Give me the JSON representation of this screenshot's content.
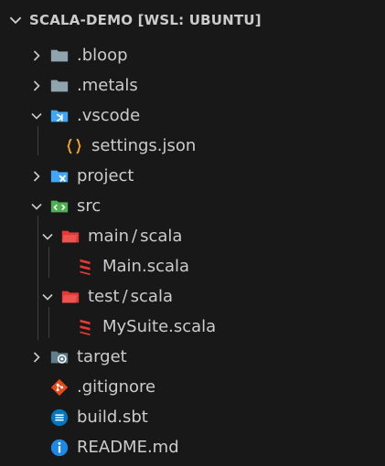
{
  "header": {
    "title": "SCALA-DEMO [WSL: UBUNTU]"
  },
  "tree": {
    "bloop": {
      "label": ".bloop",
      "icon": "folder-icon"
    },
    "metals": {
      "label": ".metals",
      "icon": "folder-icon"
    },
    "vscode": {
      "label": ".vscode",
      "icon": "vscode-folder-icon"
    },
    "settings": {
      "label": "settings.json",
      "icon": "json-icon"
    },
    "project": {
      "label": "project",
      "icon": "project-folder-icon"
    },
    "src": {
      "label": "src",
      "icon": "src-folder-icon"
    },
    "main": {
      "label": "main",
      "sep": "/",
      "label2": "scala",
      "icon": "main-folder-icon"
    },
    "main_scala": {
      "label": "Main.scala",
      "icon": "scala-icon"
    },
    "test": {
      "label": "test",
      "sep": "/",
      "label2": "scala",
      "icon": "test-folder-icon"
    },
    "mysuite": {
      "label": "MySuite.scala",
      "icon": "scala-icon"
    },
    "target": {
      "label": "target",
      "icon": "target-folder-icon"
    },
    "gitignore": {
      "label": ".gitignore",
      "icon": "git-icon"
    },
    "build": {
      "label": "build.sbt",
      "icon": "sbt-icon"
    },
    "readme": {
      "label": "README.md",
      "icon": "info-icon"
    }
  },
  "colors": {
    "background": "#181818",
    "text": "#cccccc",
    "folder_grey": "#90a4ae",
    "folder_blue": "#42a5f5",
    "src_green": "#4caf50",
    "folder_red": "#e53935",
    "scala_red": "#e53935",
    "json_orange": "#f9a825",
    "git_orange": "#e64a19",
    "sbt_blue": "#0277bd",
    "info_blue": "#1e88e5"
  }
}
